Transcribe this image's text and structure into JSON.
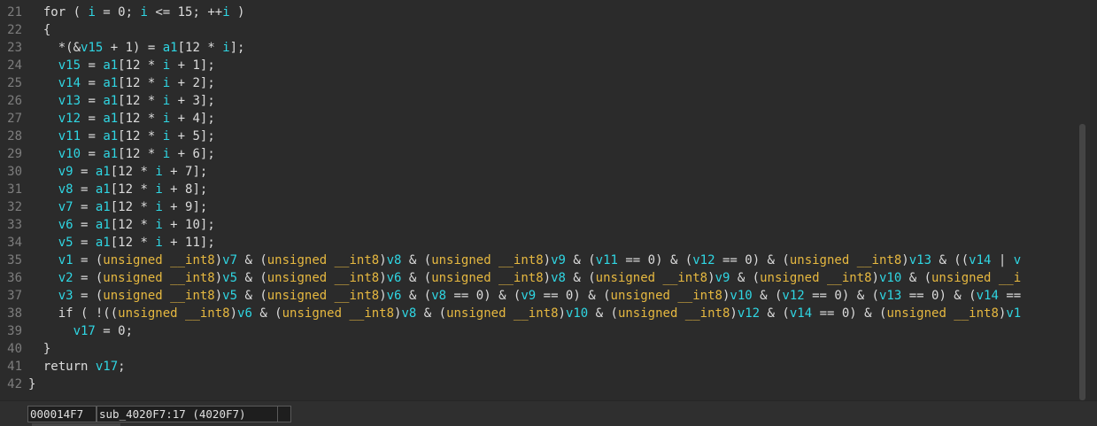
{
  "colors": {
    "background": "#2b2b2b",
    "text": "#dcdcdc",
    "variable": "#2fd6e3",
    "type_keyword": "#e6b840",
    "line_number": "#7d7d7d"
  },
  "code_lines": [
    {
      "num": "21",
      "tokens": [
        [
          "t",
          "  for ( "
        ],
        [
          "v",
          "i"
        ],
        [
          "t",
          " = 0; "
        ],
        [
          "v",
          "i"
        ],
        [
          "t",
          " <= 15; ++"
        ],
        [
          "v",
          "i"
        ],
        [
          "t",
          " )"
        ]
      ]
    },
    {
      "num": "22",
      "tokens": [
        [
          "t",
          "  {"
        ]
      ]
    },
    {
      "num": "23",
      "tokens": [
        [
          "t",
          "    *(&"
        ],
        [
          "v",
          "v15"
        ],
        [
          "t",
          " + 1) = "
        ],
        [
          "v",
          "a1"
        ],
        [
          "t",
          "[12 * "
        ],
        [
          "v",
          "i"
        ],
        [
          "t",
          "];"
        ]
      ]
    },
    {
      "num": "24",
      "tokens": [
        [
          "t",
          "    "
        ],
        [
          "v",
          "v15"
        ],
        [
          "t",
          " = "
        ],
        [
          "v",
          "a1"
        ],
        [
          "t",
          "[12 * "
        ],
        [
          "v",
          "i"
        ],
        [
          "t",
          " + 1];"
        ]
      ]
    },
    {
      "num": "25",
      "tokens": [
        [
          "t",
          "    "
        ],
        [
          "v",
          "v14"
        ],
        [
          "t",
          " = "
        ],
        [
          "v",
          "a1"
        ],
        [
          "t",
          "[12 * "
        ],
        [
          "v",
          "i"
        ],
        [
          "t",
          " + 2];"
        ]
      ]
    },
    {
      "num": "26",
      "tokens": [
        [
          "t",
          "    "
        ],
        [
          "v",
          "v13"
        ],
        [
          "t",
          " = "
        ],
        [
          "v",
          "a1"
        ],
        [
          "t",
          "[12 * "
        ],
        [
          "v",
          "i"
        ],
        [
          "t",
          " + 3];"
        ]
      ]
    },
    {
      "num": "27",
      "tokens": [
        [
          "t",
          "    "
        ],
        [
          "v",
          "v12"
        ],
        [
          "t",
          " = "
        ],
        [
          "v",
          "a1"
        ],
        [
          "t",
          "[12 * "
        ],
        [
          "v",
          "i"
        ],
        [
          "t",
          " + 4];"
        ]
      ]
    },
    {
      "num": "28",
      "tokens": [
        [
          "t",
          "    "
        ],
        [
          "v",
          "v11"
        ],
        [
          "t",
          " = "
        ],
        [
          "v",
          "a1"
        ],
        [
          "t",
          "[12 * "
        ],
        [
          "v",
          "i"
        ],
        [
          "t",
          " + 5];"
        ]
      ]
    },
    {
      "num": "29",
      "tokens": [
        [
          "t",
          "    "
        ],
        [
          "v",
          "v10"
        ],
        [
          "t",
          " = "
        ],
        [
          "v",
          "a1"
        ],
        [
          "t",
          "[12 * "
        ],
        [
          "v",
          "i"
        ],
        [
          "t",
          " + 6];"
        ]
      ]
    },
    {
      "num": "30",
      "tokens": [
        [
          "t",
          "    "
        ],
        [
          "v",
          "v9"
        ],
        [
          "t",
          " = "
        ],
        [
          "v",
          "a1"
        ],
        [
          "t",
          "[12 * "
        ],
        [
          "v",
          "i"
        ],
        [
          "t",
          " + 7];"
        ]
      ]
    },
    {
      "num": "31",
      "tokens": [
        [
          "t",
          "    "
        ],
        [
          "v",
          "v8"
        ],
        [
          "t",
          " = "
        ],
        [
          "v",
          "a1"
        ],
        [
          "t",
          "[12 * "
        ],
        [
          "v",
          "i"
        ],
        [
          "t",
          " + 8];"
        ]
      ]
    },
    {
      "num": "32",
      "tokens": [
        [
          "t",
          "    "
        ],
        [
          "v",
          "v7"
        ],
        [
          "t",
          " = "
        ],
        [
          "v",
          "a1"
        ],
        [
          "t",
          "[12 * "
        ],
        [
          "v",
          "i"
        ],
        [
          "t",
          " + 9];"
        ]
      ]
    },
    {
      "num": "33",
      "tokens": [
        [
          "t",
          "    "
        ],
        [
          "v",
          "v6"
        ],
        [
          "t",
          " = "
        ],
        [
          "v",
          "a1"
        ],
        [
          "t",
          "[12 * "
        ],
        [
          "v",
          "i"
        ],
        [
          "t",
          " + 10];"
        ]
      ]
    },
    {
      "num": "34",
      "tokens": [
        [
          "t",
          "    "
        ],
        [
          "v",
          "v5"
        ],
        [
          "t",
          " = "
        ],
        [
          "v",
          "a1"
        ],
        [
          "t",
          "[12 * "
        ],
        [
          "v",
          "i"
        ],
        [
          "t",
          " + 11];"
        ]
      ]
    },
    {
      "num": "35",
      "tokens": [
        [
          "t",
          "    "
        ],
        [
          "v",
          "v1"
        ],
        [
          "t",
          " = ("
        ],
        [
          "k",
          "unsigned __int8"
        ],
        [
          "t",
          ")"
        ],
        [
          "v",
          "v7"
        ],
        [
          "t",
          " & ("
        ],
        [
          "k",
          "unsigned __int8"
        ],
        [
          "t",
          ")"
        ],
        [
          "v",
          "v8"
        ],
        [
          "t",
          " & ("
        ],
        [
          "k",
          "unsigned __int8"
        ],
        [
          "t",
          ")"
        ],
        [
          "v",
          "v9"
        ],
        [
          "t",
          " & ("
        ],
        [
          "v",
          "v11"
        ],
        [
          "t",
          " == 0) & ("
        ],
        [
          "v",
          "v12"
        ],
        [
          "t",
          " == 0) & ("
        ],
        [
          "k",
          "unsigned __int8"
        ],
        [
          "t",
          ")"
        ],
        [
          "v",
          "v13"
        ],
        [
          "t",
          " & (("
        ],
        [
          "v",
          "v14"
        ],
        [
          "t",
          " | "
        ],
        [
          "v",
          "v"
        ]
      ]
    },
    {
      "num": "36",
      "tokens": [
        [
          "t",
          "    "
        ],
        [
          "v",
          "v2"
        ],
        [
          "t",
          " = ("
        ],
        [
          "k",
          "unsigned __int8"
        ],
        [
          "t",
          ")"
        ],
        [
          "v",
          "v5"
        ],
        [
          "t",
          " & ("
        ],
        [
          "k",
          "unsigned __int8"
        ],
        [
          "t",
          ")"
        ],
        [
          "v",
          "v6"
        ],
        [
          "t",
          " & ("
        ],
        [
          "k",
          "unsigned __int8"
        ],
        [
          "t",
          ")"
        ],
        [
          "v",
          "v8"
        ],
        [
          "t",
          " & ("
        ],
        [
          "k",
          "unsigned __int8"
        ],
        [
          "t",
          ")"
        ],
        [
          "v",
          "v9"
        ],
        [
          "t",
          " & ("
        ],
        [
          "k",
          "unsigned __int8"
        ],
        [
          "t",
          ")"
        ],
        [
          "v",
          "v10"
        ],
        [
          "t",
          " & ("
        ],
        [
          "k",
          "unsigned __i"
        ]
      ]
    },
    {
      "num": "37",
      "tokens": [
        [
          "t",
          "    "
        ],
        [
          "v",
          "v3"
        ],
        [
          "t",
          " = ("
        ],
        [
          "k",
          "unsigned __int8"
        ],
        [
          "t",
          ")"
        ],
        [
          "v",
          "v5"
        ],
        [
          "t",
          " & ("
        ],
        [
          "k",
          "unsigned __int8"
        ],
        [
          "t",
          ")"
        ],
        [
          "v",
          "v6"
        ],
        [
          "t",
          " & ("
        ],
        [
          "v",
          "v8"
        ],
        [
          "t",
          " == 0) & ("
        ],
        [
          "v",
          "v9"
        ],
        [
          "t",
          " == 0) & ("
        ],
        [
          "k",
          "unsigned __int8"
        ],
        [
          "t",
          ")"
        ],
        [
          "v",
          "v10"
        ],
        [
          "t",
          " & ("
        ],
        [
          "v",
          "v12"
        ],
        [
          "t",
          " == 0) & ("
        ],
        [
          "v",
          "v13"
        ],
        [
          "t",
          " == 0) & ("
        ],
        [
          "v",
          "v14"
        ],
        [
          "t",
          " =="
        ]
      ]
    },
    {
      "num": "38",
      "tokens": [
        [
          "t",
          "    if ( !(("
        ],
        [
          "k",
          "unsigned __int8"
        ],
        [
          "t",
          ")"
        ],
        [
          "v",
          "v6"
        ],
        [
          "t",
          " & ("
        ],
        [
          "k",
          "unsigned __int8"
        ],
        [
          "t",
          ")"
        ],
        [
          "v",
          "v8"
        ],
        [
          "t",
          " & ("
        ],
        [
          "k",
          "unsigned __int8"
        ],
        [
          "t",
          ")"
        ],
        [
          "v",
          "v10"
        ],
        [
          "t",
          " & ("
        ],
        [
          "k",
          "unsigned __int8"
        ],
        [
          "t",
          ")"
        ],
        [
          "v",
          "v12"
        ],
        [
          "t",
          " & ("
        ],
        [
          "v",
          "v14"
        ],
        [
          "t",
          " == 0) & ("
        ],
        [
          "k",
          "unsigned __int8"
        ],
        [
          "t",
          ")"
        ],
        [
          "v",
          "v1"
        ]
      ]
    },
    {
      "num": "39",
      "tokens": [
        [
          "t",
          "      "
        ],
        [
          "v",
          "v17"
        ],
        [
          "t",
          " = 0;"
        ]
      ]
    },
    {
      "num": "40",
      "tokens": [
        [
          "t",
          "  }"
        ]
      ]
    },
    {
      "num": "41",
      "tokens": [
        [
          "t",
          "  return "
        ],
        [
          "v",
          "v17"
        ],
        [
          "t",
          ";"
        ]
      ]
    },
    {
      "num": "42",
      "tokens": [
        [
          "t",
          "}"
        ]
      ]
    }
  ],
  "status": {
    "offset": "000014F7",
    "function": "sub_4020F7:17 (4020F7)",
    "extra": ""
  }
}
